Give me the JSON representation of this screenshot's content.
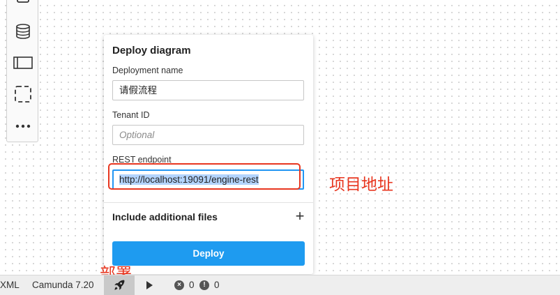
{
  "palette": {
    "tools": [
      "task-icon",
      "data-store-icon",
      "participant-icon",
      "group-icon",
      "more-icon"
    ]
  },
  "deploy_overlay": {
    "title": "Deploy diagram",
    "deployment_name": {
      "label": "Deployment name",
      "value": "请假流程"
    },
    "tenant_id": {
      "label": "Tenant ID",
      "placeholder": "Optional"
    },
    "rest_endpoint": {
      "label": "REST endpoint",
      "value": "http://localhost:19091/engine-rest"
    },
    "include_files_label": "Include additional files",
    "deploy_button": "Deploy"
  },
  "annotations": {
    "endpoint_note": "项目地址",
    "deploy_note": "部署",
    "color": "#e8361f"
  },
  "statusbar": {
    "xml_label": "XML",
    "engine_label": "Camunda 7.20",
    "errors": "0",
    "warnings": "0"
  },
  "colors": {
    "accent": "#1e9bf0",
    "focus": "#2196f3"
  }
}
